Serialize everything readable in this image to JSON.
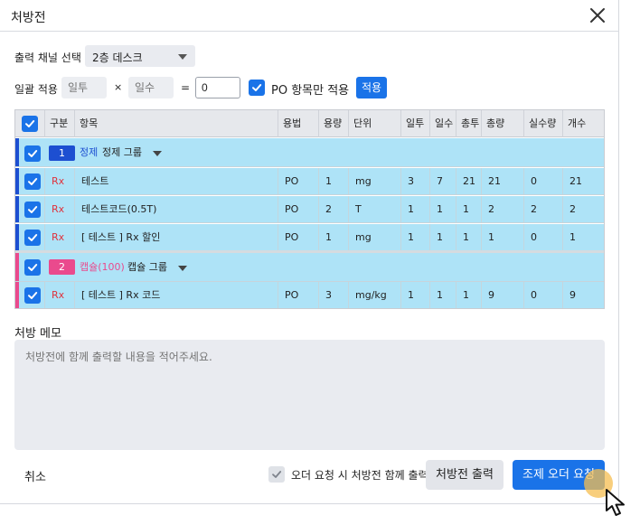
{
  "dialog": {
    "title": "처방전"
  },
  "channel": {
    "label": "출력 채널 선택",
    "selected": "2층 데스크"
  },
  "bulk": {
    "label": "일괄 적용",
    "daily_placeholder": "일투",
    "times_symbol": "×",
    "days_placeholder": "일수",
    "equals_symbol": "=",
    "total_value": "0",
    "po_only_label": "PO 항목만 적용",
    "apply_label": "적용"
  },
  "table": {
    "headers": [
      "구분",
      "항목",
      "용법",
      "용량",
      "단위",
      "일투",
      "일수",
      "총투",
      "총량",
      "실수량",
      "개수"
    ],
    "groups": [
      {
        "number": "1",
        "tag": "정제",
        "name": "정제 그룹",
        "color": "#1d4fd1",
        "rows": [
          {
            "type": "Rx",
            "item": "테스트",
            "usage": "PO",
            "dose": "1",
            "unit": "mg",
            "daily": "3",
            "days": "7",
            "total_doses": "21",
            "total_amount": "21",
            "actual": "0",
            "count": "21"
          },
          {
            "type": "Rx",
            "item": "테스트코드(0.5T)",
            "usage": "PO",
            "dose": "2",
            "unit": "T",
            "daily": "1",
            "days": "1",
            "total_doses": "1",
            "total_amount": "2",
            "actual": "2",
            "count": "2"
          },
          {
            "type": "Rx",
            "item": "[ 테스트 ] Rx 할인",
            "usage": "PO",
            "dose": "1",
            "unit": "mg",
            "daily": "1",
            "days": "1",
            "total_doses": "1",
            "total_amount": "1",
            "actual": "0",
            "count": "1"
          }
        ]
      },
      {
        "number": "2",
        "tag": "캡슐(100)",
        "name": "캡슐 그룹",
        "color": "#ea4a8d",
        "rows": [
          {
            "type": "Rx",
            "item": "[ 테스트 ] Rx 코드",
            "usage": "PO",
            "dose": "3",
            "unit": "mg/kg",
            "daily": "1",
            "days": "1",
            "total_doses": "1",
            "total_amount": "9",
            "actual": "0",
            "count": "9"
          }
        ]
      }
    ]
  },
  "memo": {
    "label": "처방 메모",
    "placeholder": "처방전에 함께 출력할 내용을 적어주세요."
  },
  "footer": {
    "cancel_label": "취소",
    "print_with_order_label": "오더 요청 시 처방전 함께 출력",
    "print_label": "처방전 출력",
    "order_label": "조제 오더 요청"
  },
  "colors": {
    "accent": "#1a73e8",
    "row_bg": "#aee3f7",
    "rx_text": "#e0323c"
  },
  "icons": {
    "close": "close-icon",
    "check": "check-icon",
    "dropdown": "chevron-down-icon",
    "cursor": "mouse-pointer-icon"
  }
}
